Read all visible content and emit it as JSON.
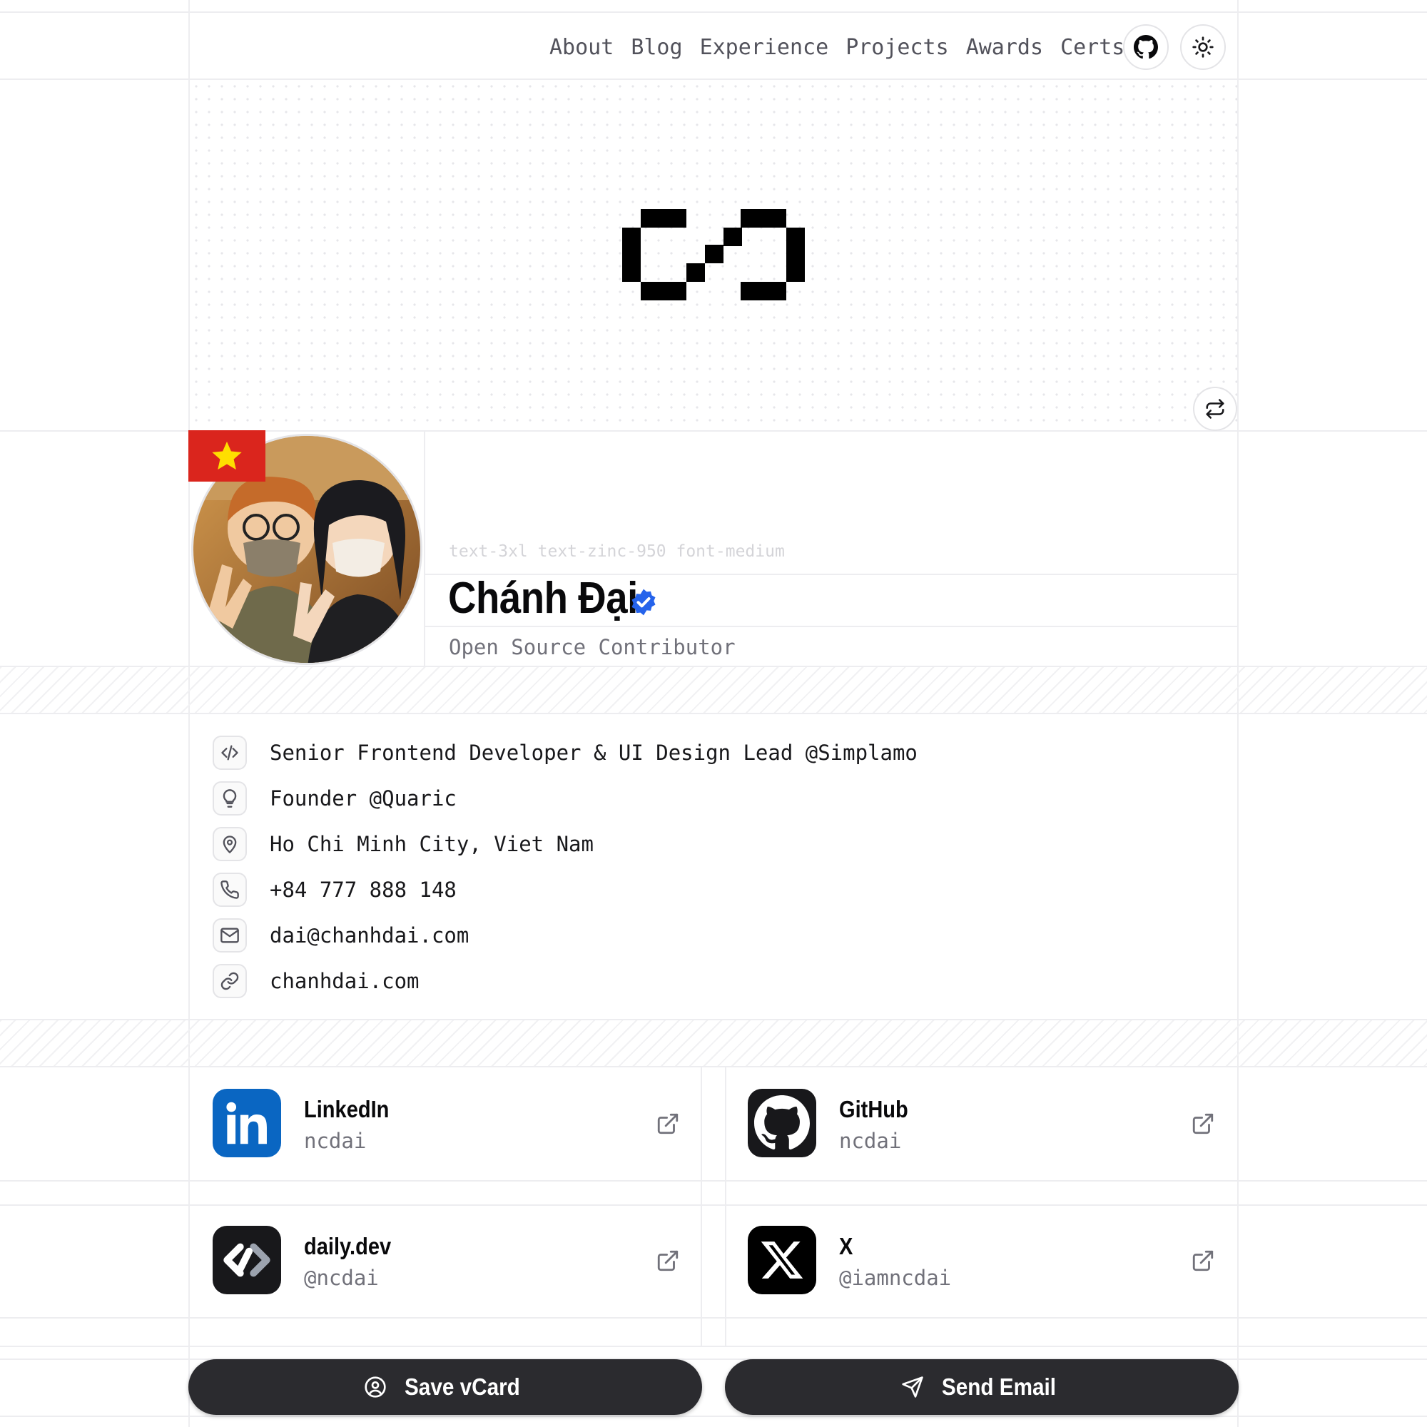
{
  "nav": {
    "links": [
      "About",
      "Blog",
      "Experience",
      "Projects",
      "Awards",
      "Certs"
    ],
    "github_icon": "github-icon",
    "theme_icon": "sun-icon"
  },
  "hero": {
    "logo_icon": "pixel-code-logo",
    "swap_icon": "repeat-icon"
  },
  "profile": {
    "hint": "text-3xl text-zinc-950 font-medium",
    "name": "Chánh Đại",
    "tagline": "Open Source Contributor",
    "verified_color": "#2563eb",
    "flag_colors": {
      "bg": "#da251d",
      "star": "#ffde00"
    }
  },
  "info": [
    {
      "icon": "code-icon",
      "text": "Senior Frontend Developer & UI Design Lead @Simplamo"
    },
    {
      "icon": "lightbulb-icon",
      "text": "Founder @Quaric"
    },
    {
      "icon": "map-pin-icon",
      "text": "Ho Chi Minh City, Viet Nam"
    },
    {
      "icon": "phone-icon",
      "text": "+84 777 888 148"
    },
    {
      "icon": "mail-icon",
      "text": "dai@chanhdai.com"
    },
    {
      "icon": "link-icon",
      "text": "chanhdai.com"
    }
  ],
  "socials": [
    {
      "name": "LinkedIn",
      "handle": "ncdai",
      "icon": "linkedin-icon",
      "color": "#0a66c2"
    },
    {
      "name": "GitHub",
      "handle": "ncdai",
      "icon": "github-icon",
      "color": "#18181b"
    },
    {
      "name": "daily.dev",
      "handle": "@ncdai",
      "icon": "dailydev-icon",
      "color": "#18181b"
    },
    {
      "name": "X",
      "handle": "@iamncdai",
      "icon": "x-icon",
      "color": "#000000"
    }
  ],
  "actions": {
    "save": "Save vCard",
    "email": "Send Email"
  }
}
